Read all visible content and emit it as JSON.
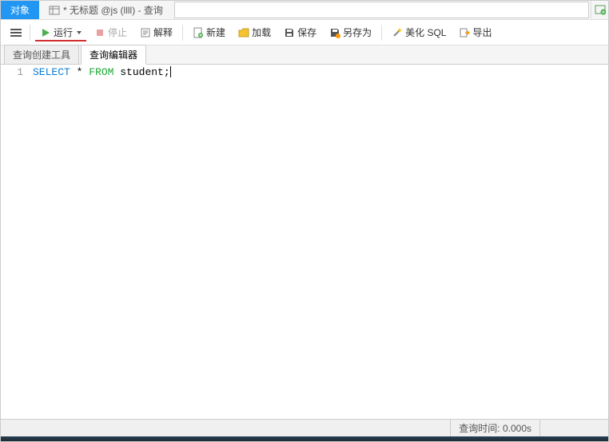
{
  "tabs": {
    "objects": "对象",
    "query": "* 无标题 @js (llll) - 查询"
  },
  "toolbar": {
    "run": "运行",
    "stop": "停止",
    "explain": "解释",
    "new": "新建",
    "load": "加载",
    "save": "保存",
    "saveAs": "另存为",
    "beautify": "美化 SQL",
    "export": "导出"
  },
  "subTabs": {
    "builder": "查询创建工具",
    "editor": "查询编辑器"
  },
  "editor": {
    "lineNumber": "1",
    "selectKw": "SELECT",
    "star": " * ",
    "fromKw": "FROM",
    "rest": " student;"
  },
  "status": {
    "queryTime": "查询时间: 0.000s"
  }
}
